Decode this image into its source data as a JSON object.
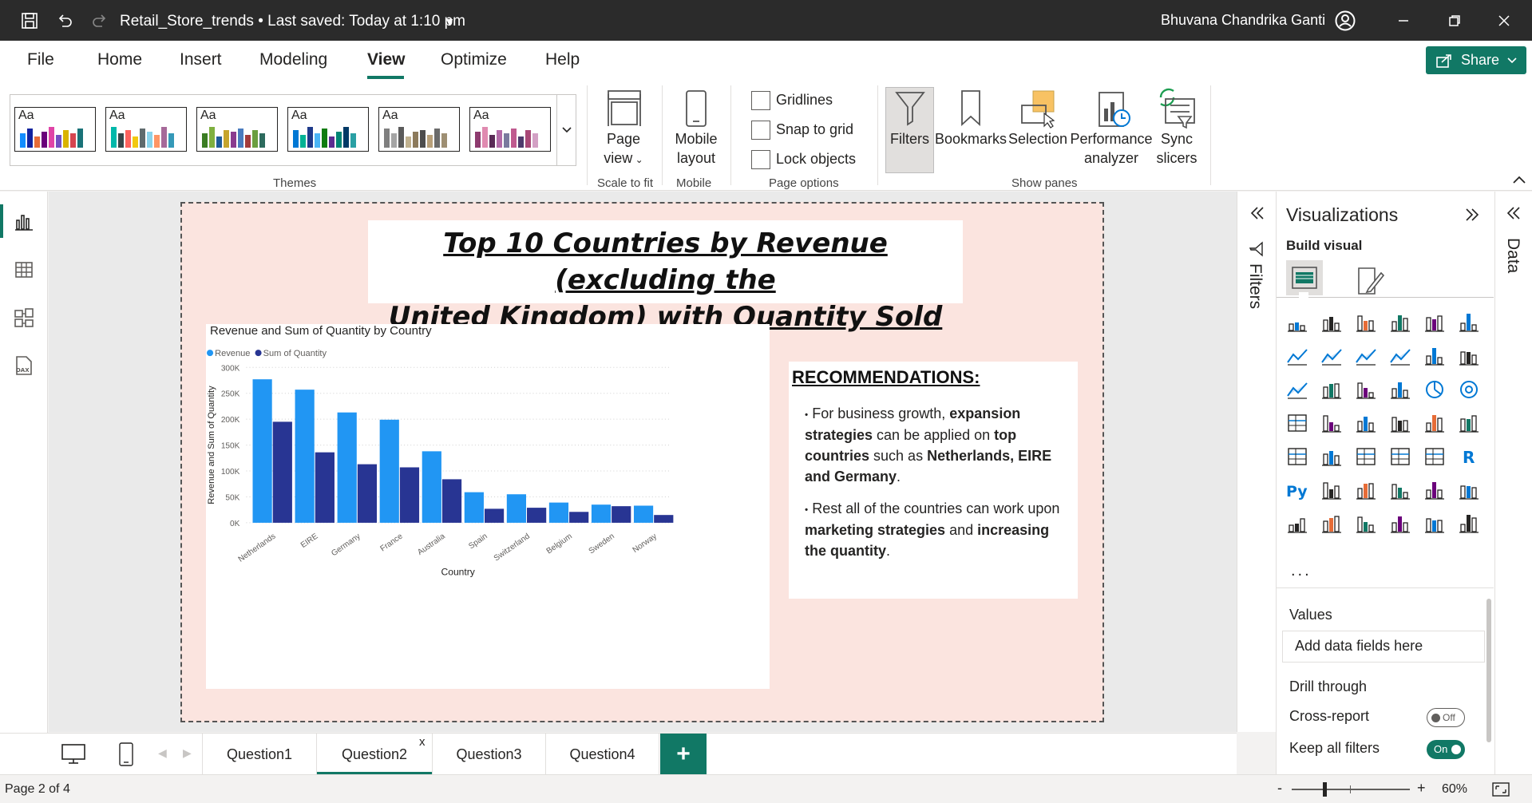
{
  "titlebar": {
    "document_title": "Retail_Store_trends • Last saved: Today at 1:10 pm",
    "user_name": "Bhuvana Chandrika Ganti"
  },
  "menu": {
    "items": [
      "File",
      "Home",
      "Insert",
      "Modeling",
      "View",
      "Optimize",
      "Help"
    ],
    "active": "View",
    "share_label": "Share"
  },
  "ribbon": {
    "themes_label": "Themes",
    "page_view_label": "Page view",
    "scale_label": "Scale to fit",
    "mobile_layout_label": "Mobile layout",
    "mobile_label": "Mobile",
    "gridlines_label": "Gridlines",
    "snap_label": "Snap to grid",
    "lock_label": "Lock objects",
    "page_options_label": "Page options",
    "filters_label": "Filters",
    "bookmarks_label": "Bookmarks",
    "selection_label": "Selection",
    "performance_label": "Performance analyzer",
    "sync_label": "Sync slicers",
    "show_panes_label": "Show panes",
    "theme_swatch_text": "Aa"
  },
  "report": {
    "title_line1": "Top 10 Countries by Revenue (excluding the",
    "title_line2": "United Kingdom) with Quantity Sold",
    "rec_title": "RECOMMENDATIONS:"
  },
  "chart_data": {
    "type": "bar",
    "title": "Revenue and Sum of Quantity by Country",
    "xlabel": "Country",
    "ylabel": "Revenue and Sum of Quantity",
    "categories": [
      "Netherlands",
      "EIRE",
      "Germany",
      "France",
      "Australia",
      "Spain",
      "Switzerland",
      "Belgium",
      "Sweden",
      "Norway"
    ],
    "series": [
      {
        "name": "Revenue",
        "color": "#2196f3",
        "values": [
          277000,
          257000,
          213000,
          199000,
          138000,
          59000,
          55000,
          39000,
          35000,
          33000
        ]
      },
      {
        "name": "Sum of Quantity",
        "color": "#283593",
        "values": [
          195000,
          136000,
          113000,
          107000,
          84000,
          27000,
          29000,
          21000,
          32000,
          15000
        ]
      }
    ],
    "ylim": [
      0,
      300000
    ],
    "yticks": [
      "0K",
      "50K",
      "100K",
      "150K",
      "200K",
      "250K",
      "300K"
    ],
    "grid": true,
    "legend": "top-left"
  },
  "viz": {
    "title": "Visualizations",
    "build_visual": "Build visual",
    "values_label": "Values",
    "add_fields": "Add data fields here",
    "drill_through": "Drill through",
    "cross_report": "Cross-report",
    "cross_report_state": "Off",
    "keep_filters": "Keep all filters",
    "keep_filters_state": "On",
    "more": "..."
  },
  "panes": {
    "filters_label": "Filters",
    "data_label": "Data"
  },
  "tabs": {
    "items": [
      "Question1",
      "Question2",
      "Question3",
      "Question4"
    ],
    "active": "Question2",
    "close_glyph": "x",
    "add_glyph": "+"
  },
  "status": {
    "page_info": "Page 2 of 4",
    "zoom": "60%",
    "minus": "-",
    "plus": "+"
  }
}
